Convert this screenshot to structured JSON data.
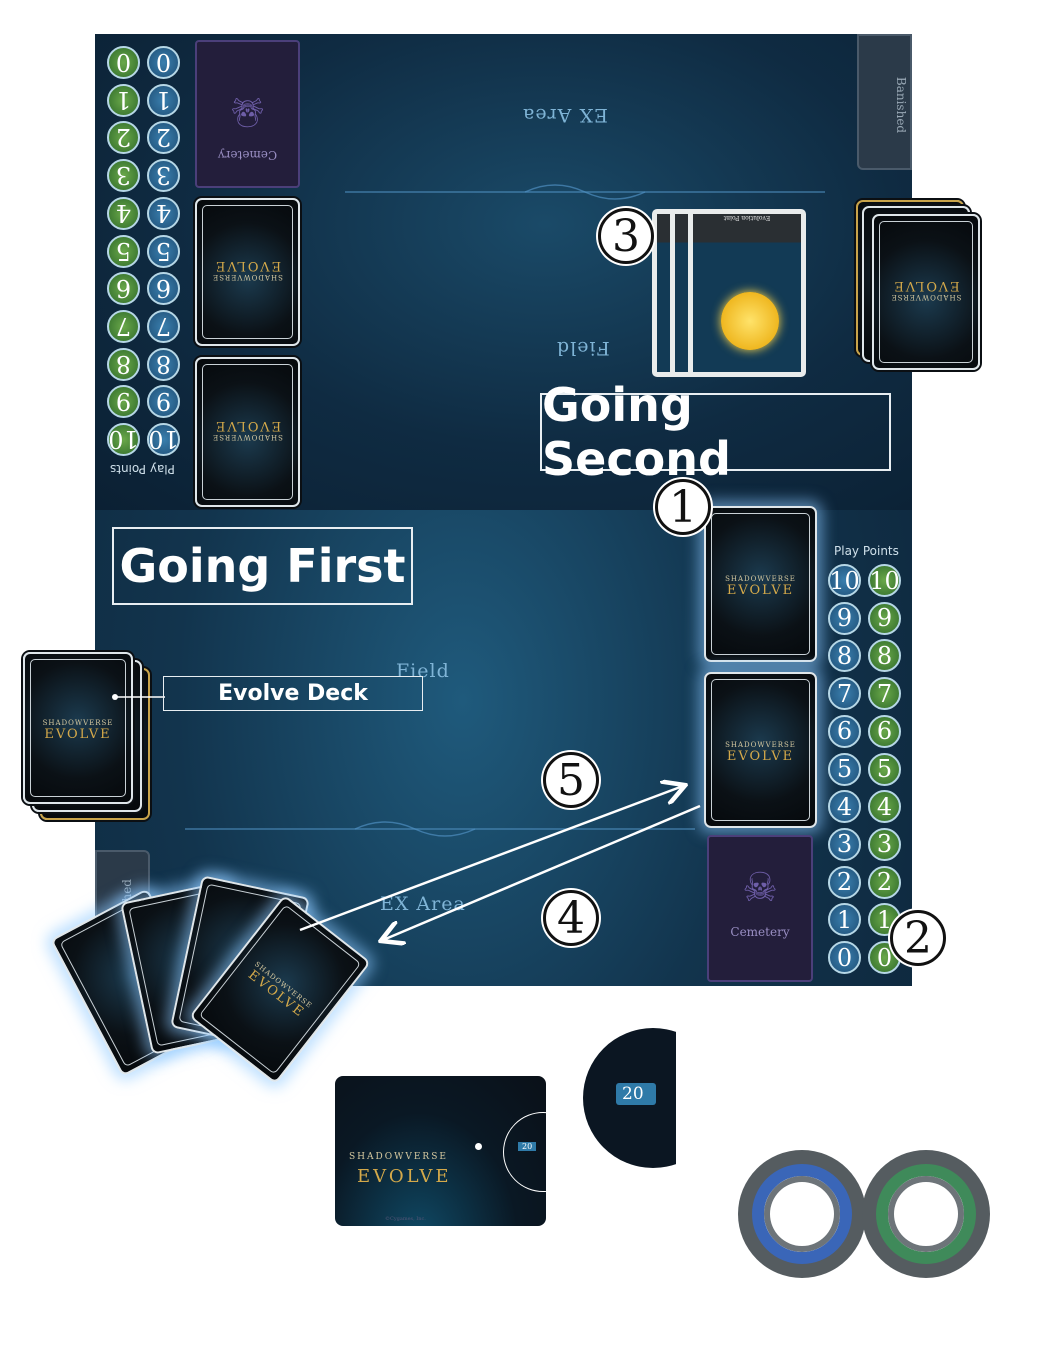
{
  "board": {
    "opponent": {
      "play_points_label": "Play Points",
      "play_points": [
        0,
        1,
        2,
        3,
        4,
        5,
        6,
        7,
        8,
        9,
        10
      ],
      "cemetery_label": "Cemetery",
      "ex_area_label": "EX Area",
      "field_label": "Field",
      "banished_label": "Banished"
    },
    "player": {
      "play_points_label": "Play Points",
      "play_points": [
        10,
        9,
        8,
        7,
        6,
        5,
        4,
        3,
        2,
        1,
        0
      ],
      "cemetery_label": "Cemetery",
      "ex_area_label": "EX Area",
      "field_label": "Field",
      "banished_label": "Banished"
    }
  },
  "labels": {
    "going_first": "Going First",
    "going_second": "Going Second",
    "evolve_deck": "Evolve Deck"
  },
  "callouts": [
    "1",
    "2",
    "3",
    "4",
    "5"
  ],
  "evolution_point_card": {
    "title": "Evolution Point"
  },
  "logo": {
    "top": "SHADOWVERSE",
    "bottom": "EVOLVE",
    "copyright": "©Cygames, Inc."
  },
  "life_counter": {
    "value": "20"
  },
  "tokens": [
    {
      "color": "blue",
      "hex": "#3a66b8"
    },
    {
      "color": "green",
      "hex": "#3f8a5a"
    }
  ],
  "colors": {
    "board": "#12344d",
    "blue_point": "#2f6e9c",
    "green_point": "#4f8f3a",
    "cemetery": "#231e3b"
  }
}
